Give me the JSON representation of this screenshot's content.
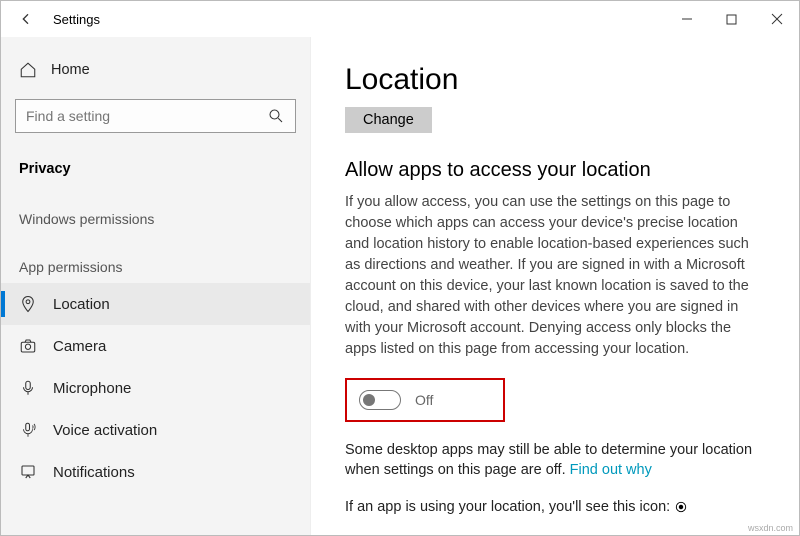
{
  "window": {
    "title": "Settings"
  },
  "sidebar": {
    "home": "Home",
    "search_placeholder": "Find a setting",
    "heading": "Privacy",
    "group1": "Windows permissions",
    "group2": "App permissions",
    "items": {
      "location": "Location",
      "camera": "Camera",
      "microphone": "Microphone",
      "voice": "Voice activation",
      "notifications": "Notifications"
    }
  },
  "main": {
    "title": "Location",
    "change_btn": "Change",
    "section_title": "Allow apps to access your location",
    "desc": "If you allow access, you can use the settings on this page to choose which apps can access your device's precise location and location history to enable location-based experiences such as directions and weather. If you are signed in with a Microsoft account on this device, your last known location is saved to the cloud, and shared with other devices where you are signed in with your Microsoft account. Denying access only blocks the apps listed on this page from accessing your location.",
    "toggle_state": "Off",
    "note_text": "Some desktop apps may still be able to determine your location when settings on this page are off. ",
    "note_link": "Find out why",
    "icon_text": "If an app is using your location, you'll see this icon: "
  },
  "watermark": "wsxdn.com"
}
